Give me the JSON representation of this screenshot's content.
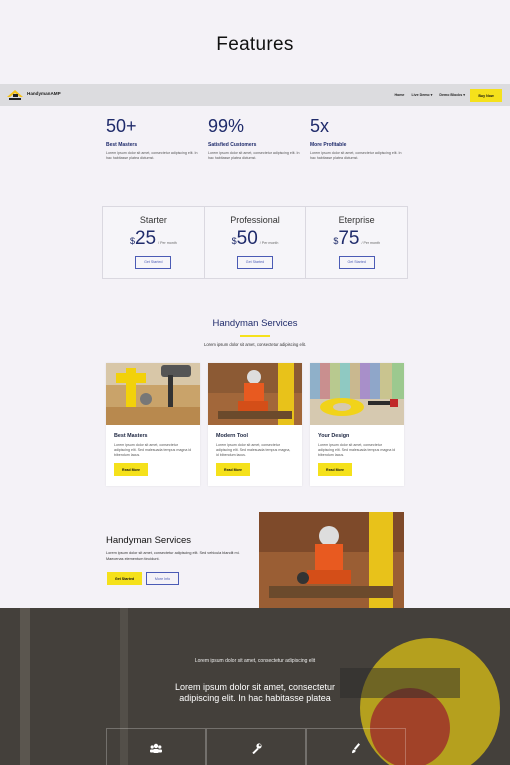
{
  "page_title": "Features",
  "navbar": {
    "brand": "HandymanAMP",
    "links": [
      "Home",
      "Live Demo ▾",
      "Demo Blocks ▾"
    ],
    "buy_label": "Buy Now"
  },
  "stats": [
    {
      "number": "50+",
      "label": "Best Masters",
      "text": "Lorem ipsum dolor sit amet, consectetur adipiscing elit. In hac habitasse platea dictumst."
    },
    {
      "number": "99%",
      "label": "Satisfied Customers",
      "text": "Lorem ipsum dolor sit amet, consectetur adipiscing elit. In hac habitasse platea dictumst."
    },
    {
      "number": "5x",
      "label": "More Profitable",
      "text": "Lorem ipsum dolor sit amet, consectetur adipiscing elit. In hac habitasse platea dictumst."
    }
  ],
  "pricing": [
    {
      "name": "Starter",
      "currency": "$",
      "amount": "25",
      "per": "/ Per month",
      "button": "Get Started"
    },
    {
      "name": "Professional",
      "currency": "$",
      "amount": "50",
      "per": "/ Per month",
      "button": "Get Started"
    },
    {
      "name": "Eterprise",
      "currency": "$",
      "amount": "75",
      "per": "/ Per month",
      "button": "Get Started"
    }
  ],
  "services": {
    "title": "Handyman Services",
    "subtitle": "Lorem ipsum dolor sit amet, consectetur adipiscing elit.",
    "cards": [
      {
        "title": "Best Masters",
        "text": "Lorem ipsum dolor sit amet, consectetur adipiscing elit. Sed malesuada tempus magna id bibendum lacus.",
        "button": "Read More"
      },
      {
        "title": "Modern Tool",
        "text": "Lorem ipsum dolor sit amet, consectetur adipiscing elit. Sed malesuada tempus magna, id bibendum lacus.",
        "button": "Read More"
      },
      {
        "title": "Your Design",
        "text": "Lorem ipsum dolor sit amet, consectetur adipiscing elit. Sed malesuada tempus magna id bibendum lacus.",
        "button": "Read More"
      }
    ]
  },
  "feature": {
    "title": "Handyman Services",
    "text": "Lorem ipsum dolor sit amet, consectetur adipiscing elit. Sed vehicula blandit mi. Maecenas elementum tincidunt.",
    "primary_button": "Get Started",
    "secondary_button": "More Info"
  },
  "hero": {
    "small": "Lorem ipsum dolor sit amet, consectetur adipiscing elit",
    "big": "Lorem ipsum dolor sit amet, consectetur adipiscing elit. In hac habitasse platea",
    "icons": [
      "users-icon",
      "wrench-icon",
      "paintbrush-icon"
    ]
  },
  "colors": {
    "accent": "#f5e11b",
    "navy": "#1f2b6b",
    "outline": "#4b5bb5"
  }
}
